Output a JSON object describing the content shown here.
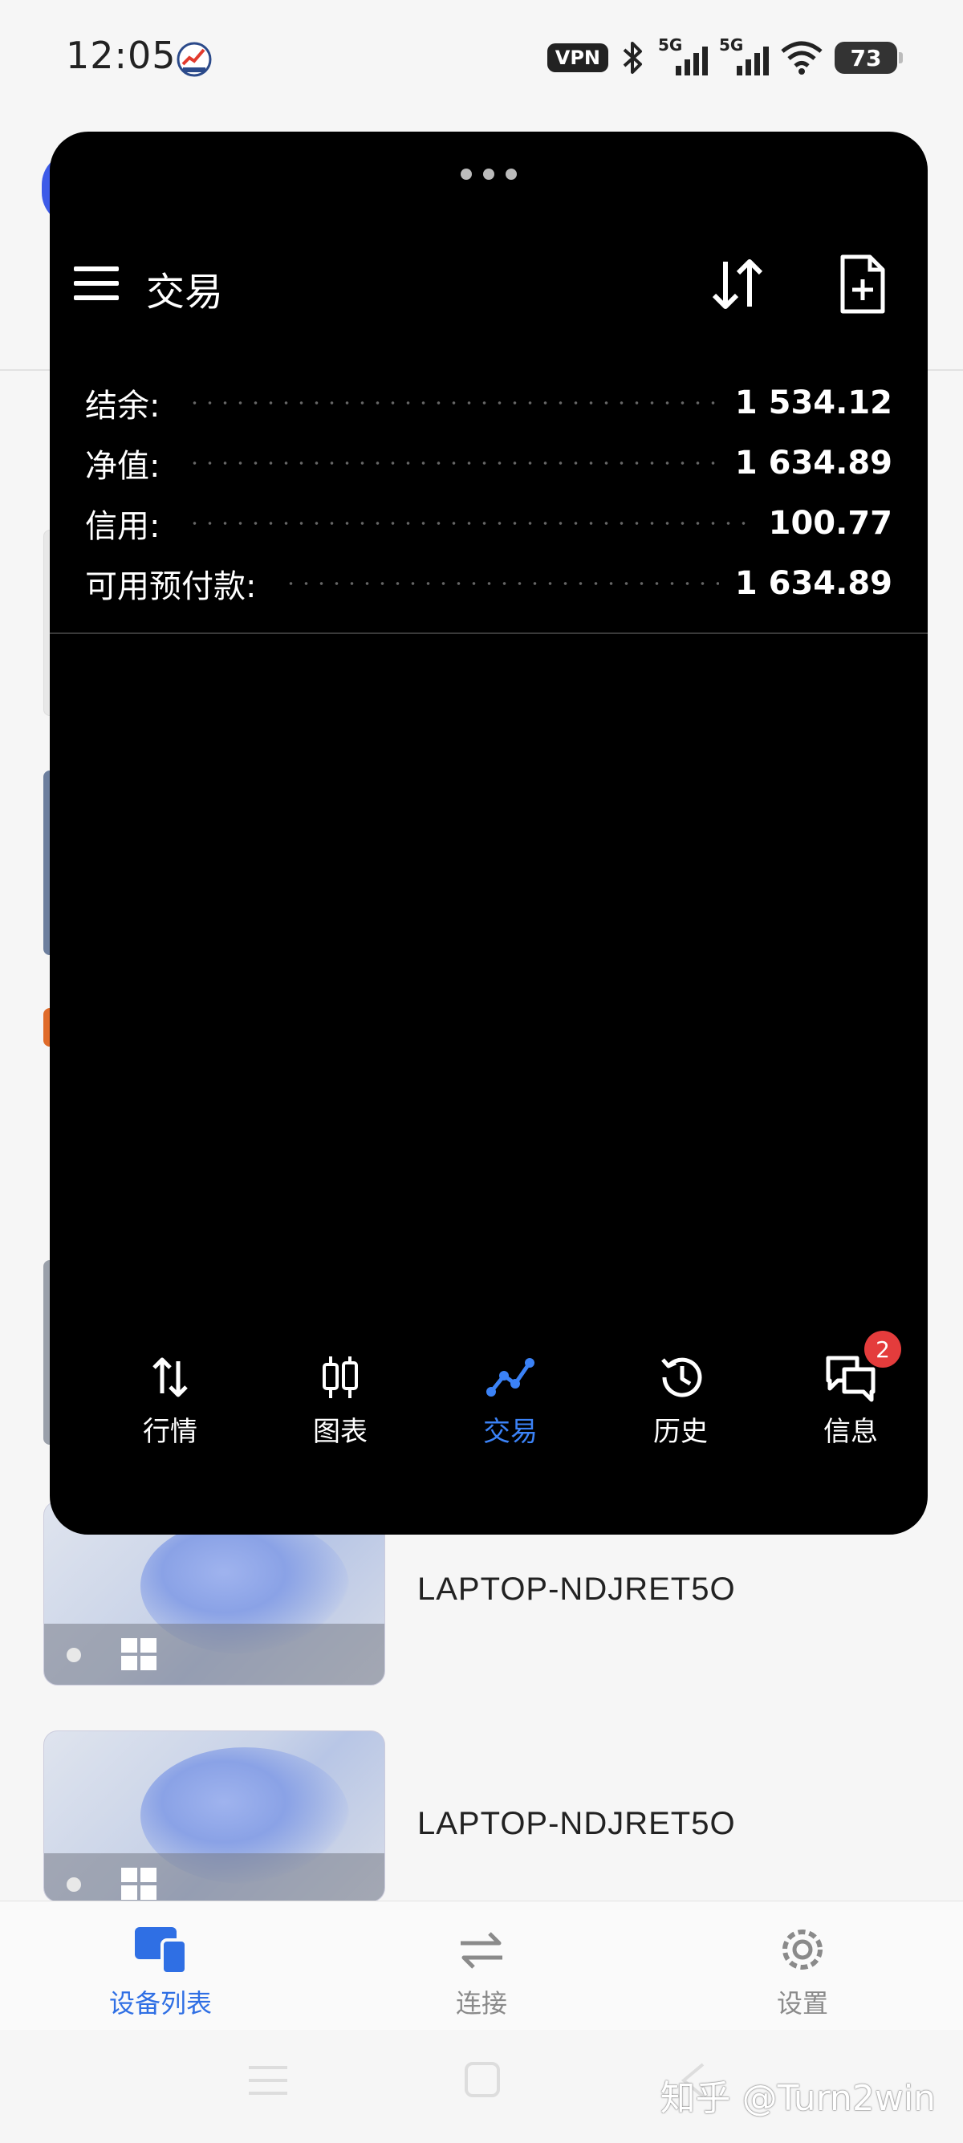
{
  "status_bar": {
    "time": "12:05",
    "vpn": "VPN",
    "signal1": "5G",
    "signal2": "5G",
    "battery": "73"
  },
  "float_window": {
    "title": "交易",
    "account": [
      {
        "label": "结余:",
        "value": "1 534.12"
      },
      {
        "label": "净值:",
        "value": "1 634.89"
      },
      {
        "label": "信用:",
        "value": "100.77"
      },
      {
        "label": "可用预付款:",
        "value": "1 634.89"
      }
    ],
    "tabs": [
      {
        "label": "行情"
      },
      {
        "label": "图表"
      },
      {
        "label": "交易"
      },
      {
        "label": "历史"
      },
      {
        "label": "信息",
        "badge": "2"
      }
    ],
    "accent_color": "#3b82f6"
  },
  "devices": [
    {
      "name": "LAPTOP-NDJRET5O"
    },
    {
      "name": "LAPTOP-NDJRET5O"
    }
  ],
  "bottom_nav": {
    "items": [
      {
        "label": "设备列表"
      },
      {
        "label": "连接"
      },
      {
        "label": "设置"
      }
    ],
    "active_color": "#2f6fe4"
  },
  "watermark": "知乎 @Turn2win"
}
